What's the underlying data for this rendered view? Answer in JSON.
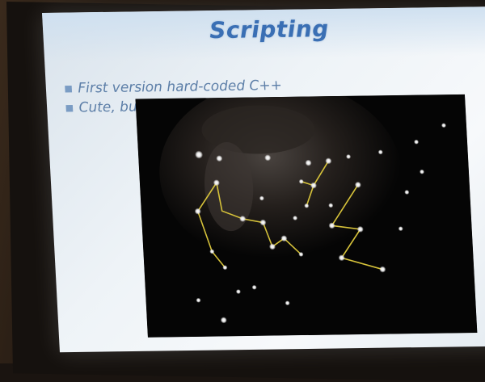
{
  "slide": {
    "title": "Scripting",
    "bullets": [
      "First version hard-coded C++",
      "Cute, but inflexible"
    ]
  },
  "viewer": {
    "footer_caption": "",
    "node_color": "#ffffff",
    "link_color": "#d6c23a"
  },
  "colors": {
    "title": "#3a6fb4",
    "bullet_text": "#5d7fa8",
    "slide_background": "#eef3f7"
  }
}
